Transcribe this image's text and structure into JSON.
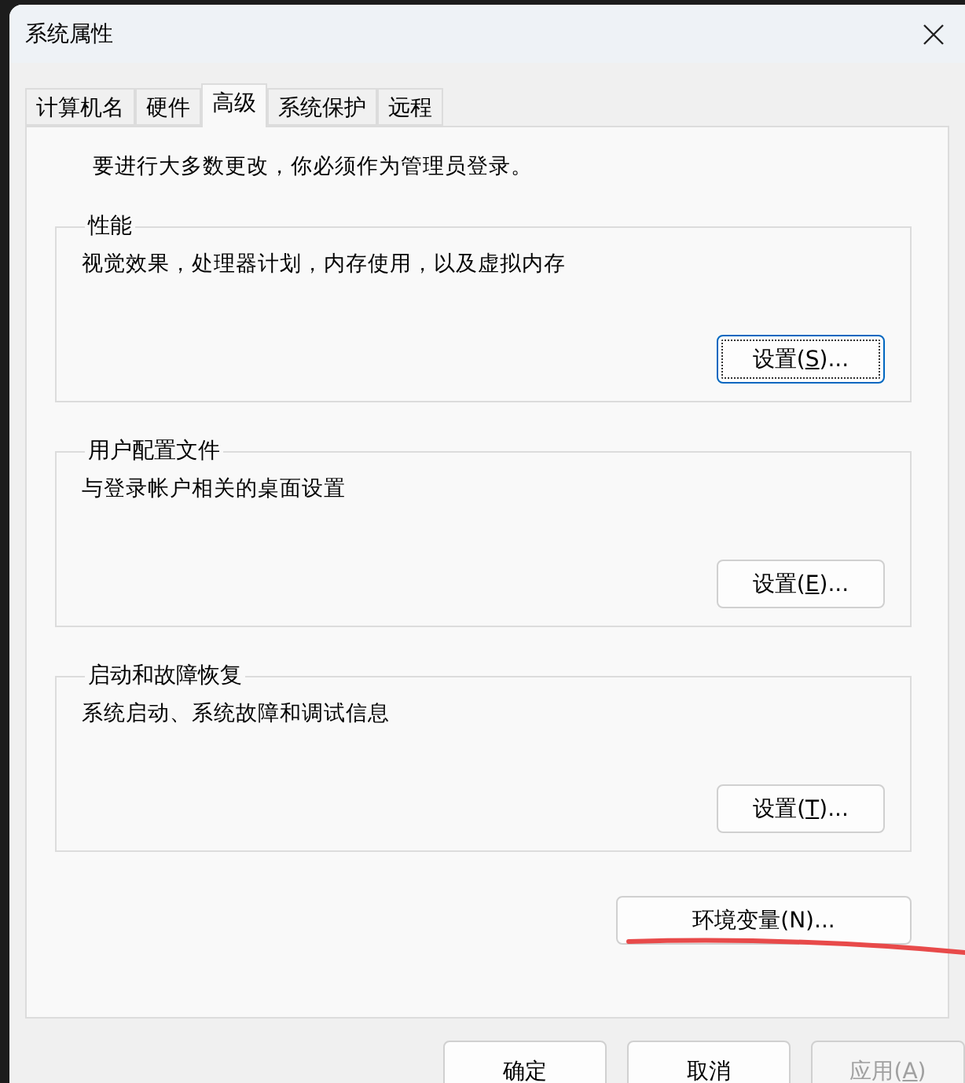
{
  "window": {
    "title": "系统属性"
  },
  "tabs": [
    {
      "label": "计算机名",
      "selected": false
    },
    {
      "label": "硬件",
      "selected": false
    },
    {
      "label": "高级",
      "selected": true
    },
    {
      "label": "系统保护",
      "selected": false
    },
    {
      "label": "远程",
      "selected": false
    }
  ],
  "notice": "要进行大多数更改，你必须作为管理员登录。",
  "groups": [
    {
      "title": "性能",
      "description": "视觉效果，处理器计划，内存使用，以及虚拟内存",
      "button": {
        "parts": [
          "设置(",
          "S",
          ")..."
        ],
        "focused": true
      }
    },
    {
      "title": "用户配置文件",
      "description": "与登录帐户相关的桌面设置",
      "button": {
        "parts": [
          "设置(",
          "E",
          ")..."
        ],
        "focused": false
      }
    },
    {
      "title": "启动和故障恢复",
      "description": "系统启动、系统故障和调试信息",
      "button": {
        "parts": [
          "设置(",
          "T",
          ")..."
        ],
        "focused": false
      }
    }
  ],
  "env_button": {
    "parts": [
      "环境变量(N)..."
    ],
    "focused": false
  },
  "footer_buttons": [
    {
      "parts": [
        "确定"
      ],
      "disabled": false
    },
    {
      "parts": [
        "取消"
      ],
      "disabled": false
    },
    {
      "parts": [
        "应用(",
        "A",
        ")"
      ],
      "disabled": true
    }
  ]
}
